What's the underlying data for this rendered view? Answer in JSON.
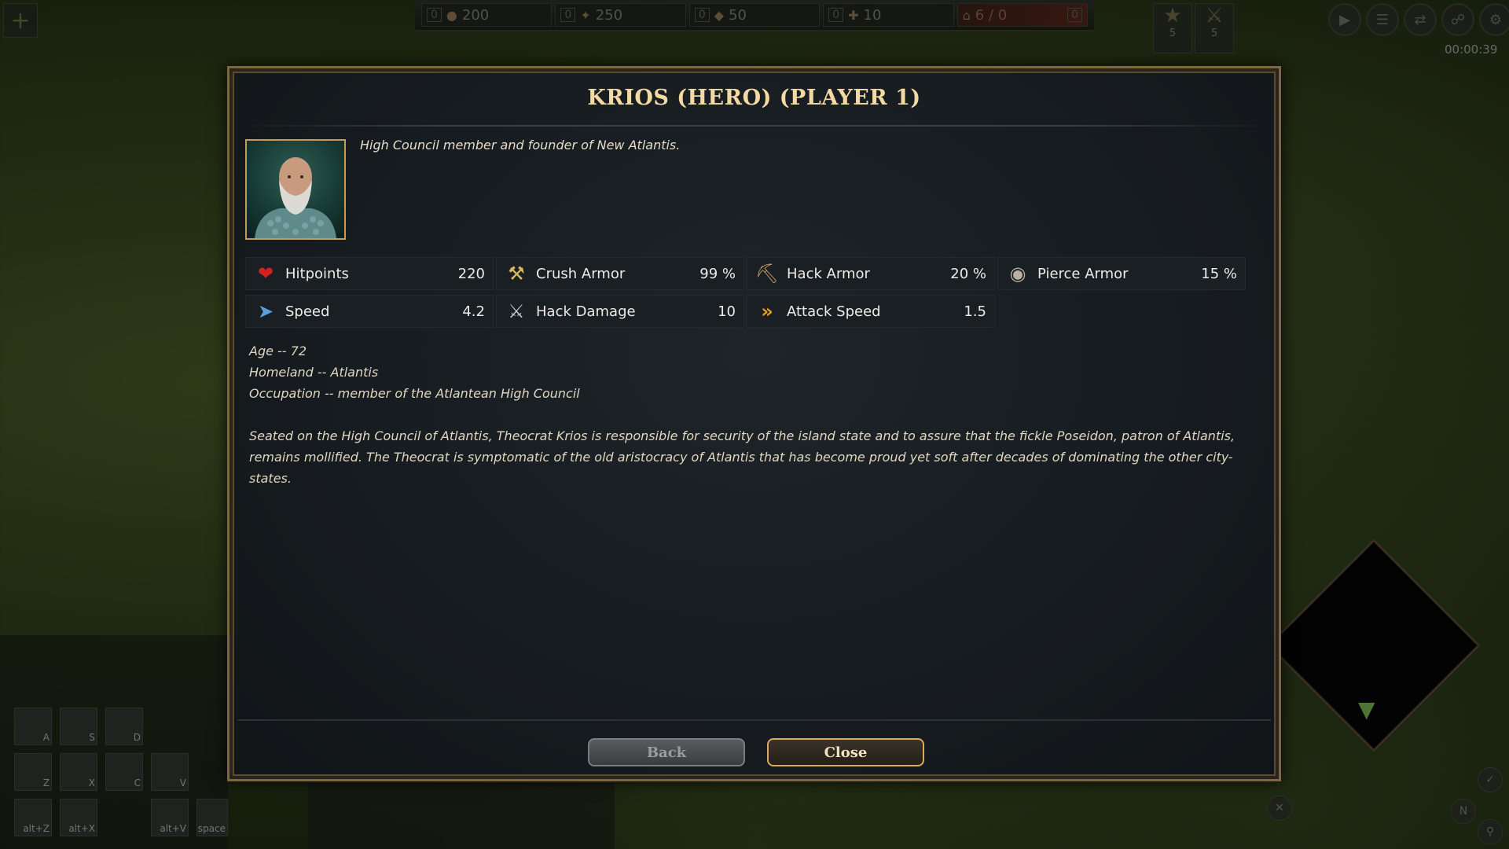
{
  "hud": {
    "resources": [
      {
        "queue": "0",
        "icon": "food-icon",
        "value": "200"
      },
      {
        "queue": "0",
        "icon": "wood-icon",
        "value": "250"
      },
      {
        "queue": "0",
        "icon": "gold-icon",
        "value": "50"
      },
      {
        "queue": "0",
        "icon": "favor-icon",
        "value": "10"
      }
    ],
    "population": {
      "value": "6 / 0",
      "queue": "0"
    },
    "god_powers": [
      {
        "count": "5"
      },
      {
        "count": "5"
      }
    ],
    "clock": "00:00:39",
    "command_keys": [
      "A",
      "S",
      "D",
      "Z",
      "X",
      "C",
      "V",
      "alt+Z",
      "alt+X",
      "alt+V",
      "space"
    ]
  },
  "dialog": {
    "title": "KRIOS (HERO) (PLAYER 1)",
    "tagline": "High Council member and founder of New Atlantis.",
    "stats": [
      {
        "icon": "heart-icon",
        "label": "Hitpoints",
        "value": "220"
      },
      {
        "icon": "crush-armor-icon",
        "label": "Crush Armor",
        "value": "99 %"
      },
      {
        "icon": "hack-armor-icon",
        "label": "Hack Armor",
        "value": "20 %"
      },
      {
        "icon": "pierce-armor-icon",
        "label": "Pierce Armor",
        "value": "15 %"
      },
      {
        "icon": "speed-icon",
        "label": "Speed",
        "value": "4.2"
      },
      {
        "icon": "hack-damage-icon",
        "label": "Hack Damage",
        "value": "10"
      },
      {
        "icon": "attack-speed-icon",
        "label": "Attack Speed",
        "value": "1.5"
      }
    ],
    "bio": {
      "age": "Age -- 72",
      "homeland": "Homeland -- Atlantis",
      "occupation": "Occupation -- member of the Atlantean High Council",
      "description": "Seated on the High Council of Atlantis, Theocrat Krios is responsible for security of the island state and to assure that the fickle Poseidon, patron of Atlantis, remains mollified. The Theocrat is symptomatic of the old aristocracy of Atlantis that has become proud yet soft after decades of dominating the other city-states."
    },
    "buttons": {
      "back": "Back",
      "close": "Close"
    }
  },
  "colors": {
    "title": "#f3d9a3",
    "close_border": "#d7aa5c",
    "frame": "#7b6840"
  }
}
